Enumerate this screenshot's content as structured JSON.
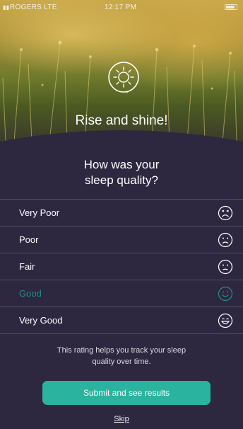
{
  "status_bar": {
    "carrier": "ROGERS LTE",
    "time": "12:17 PM"
  },
  "hero": {
    "title": "Rise and shine!",
    "icon": "sun-icon"
  },
  "question": {
    "line1": "How was your",
    "line2": "sleep quality?"
  },
  "options": [
    {
      "label": "Very Poor",
      "icon": "very-sad-face-icon"
    },
    {
      "label": "Poor",
      "icon": "sad-face-icon"
    },
    {
      "label": "Fair",
      "icon": "neutral-face-icon"
    },
    {
      "label": "Good",
      "icon": "happy-face-icon",
      "selected": true
    },
    {
      "label": "Very Good",
      "icon": "very-happy-face-icon"
    }
  ],
  "helper_text": "This rating helps you track your sleep quality over time.",
  "submit_label": "Submit and see results",
  "skip_label": "Skip",
  "colors": {
    "background": "#2e2740",
    "accent": "#2ab39e",
    "selected_text": "#1f8f8a"
  }
}
